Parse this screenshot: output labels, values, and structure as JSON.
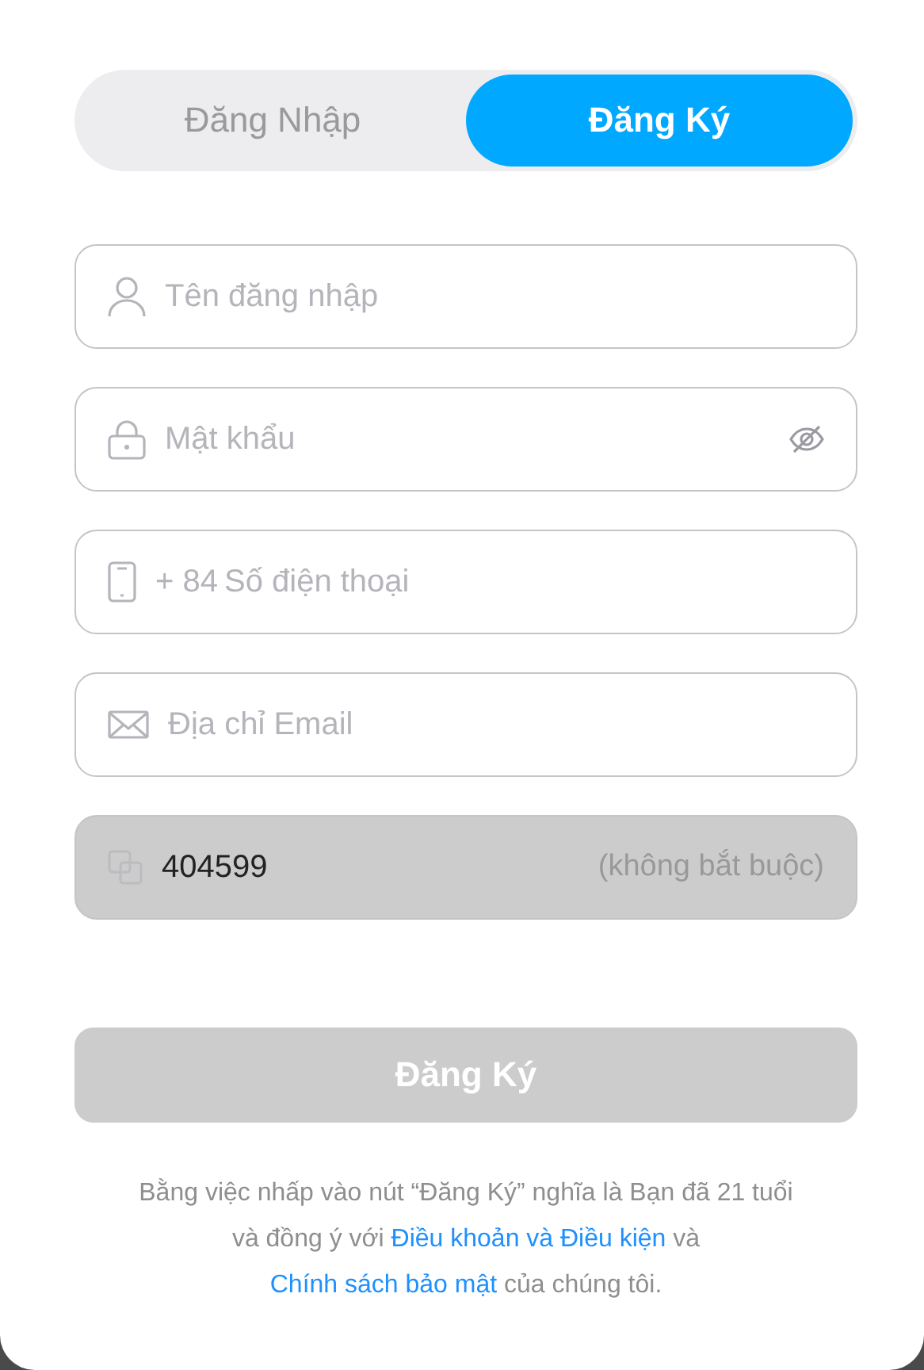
{
  "tabs": [
    {
      "label": "Đăng Nhập",
      "selected": false
    },
    {
      "label": "Đăng Ký",
      "selected": true
    }
  ],
  "fields": [
    {
      "kind": "username",
      "placeholder": "Tên đăng nhập",
      "disabled": false
    },
    {
      "kind": "password",
      "placeholder": "Mật khẩu",
      "disabled": false
    },
    {
      "kind": "phone",
      "prefix": "+ 84",
      "placeholder": "Số điện thoại",
      "disabled": false
    },
    {
      "kind": "email",
      "placeholder": "Địa chỉ Email",
      "disabled": false
    },
    {
      "kind": "referral",
      "value": "404599",
      "suffix": "(không bắt buộc)",
      "disabled": true
    }
  ],
  "submit": {
    "label": "Đăng Ký",
    "disabled": true
  },
  "terms": [
    {
      "kind": "text",
      "text": "Bằng việc nhấp vào nút “Đăng Ký” nghĩa là Bạn đã 21 tuổi và đồng ý với "
    },
    {
      "kind": "link",
      "text": "Điều khoản và Điều kiện"
    },
    {
      "kind": "text",
      "text": " và "
    },
    {
      "kind": "link",
      "text": "Chính sách bảo mật"
    },
    {
      "kind": "text",
      "text": " của chúng tôi."
    }
  ]
}
